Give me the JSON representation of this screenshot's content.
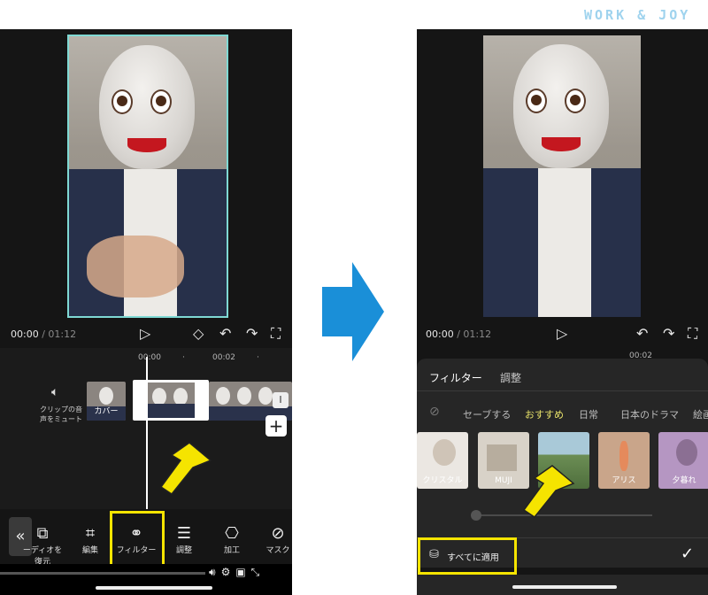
{
  "brand": "WORK & JOY",
  "left": {
    "time_current": "00:00",
    "time_sep": "/",
    "time_total": "01:12",
    "ruler": [
      "00:00",
      "00:02",
      "·",
      "·"
    ],
    "mute_label_line1": "クリップの音",
    "mute_label_line2": "声をミュート",
    "cover_label": "カバー",
    "add_label": "+",
    "tools": [
      {
        "icon": "video-restore-icon",
        "label_line1": "ーディオを",
        "label_line2": "復元"
      },
      {
        "icon": "crop-icon",
        "label_line1": "編集"
      },
      {
        "icon": "filter-icon",
        "label_line1": "フィルター"
      },
      {
        "icon": "adjust-icon",
        "label_line1": "調整"
      },
      {
        "icon": "process-icon",
        "label_line1": "加工"
      },
      {
        "icon": "mask-icon",
        "label_line1": "マスク"
      }
    ],
    "collapse_label": "«"
  },
  "right": {
    "time_current": "00:00",
    "time_sep": "/",
    "time_total": "01:12",
    "ruler": [
      "00:02"
    ],
    "tabs": [
      "フィルター",
      "調整"
    ],
    "categories": [
      "セーブする",
      "おすすめ",
      "日常",
      "日本のドラマ",
      "絵画"
    ],
    "active_category": "おすすめ",
    "filters": [
      {
        "name": "クリスタル",
        "color": "#e9e5e0"
      },
      {
        "name": "MUJI",
        "color": "#d8d2c8"
      },
      {
        "name": "",
        "color": "#6c8e55"
      },
      {
        "name": "アリス",
        "color": "#c9a58a"
      },
      {
        "name": "夕暮れ",
        "color": "#b596c2"
      }
    ],
    "apply_all": "すべてに適用"
  },
  "accent": "#f5e400",
  "arrow_color": "#1a8fd8"
}
